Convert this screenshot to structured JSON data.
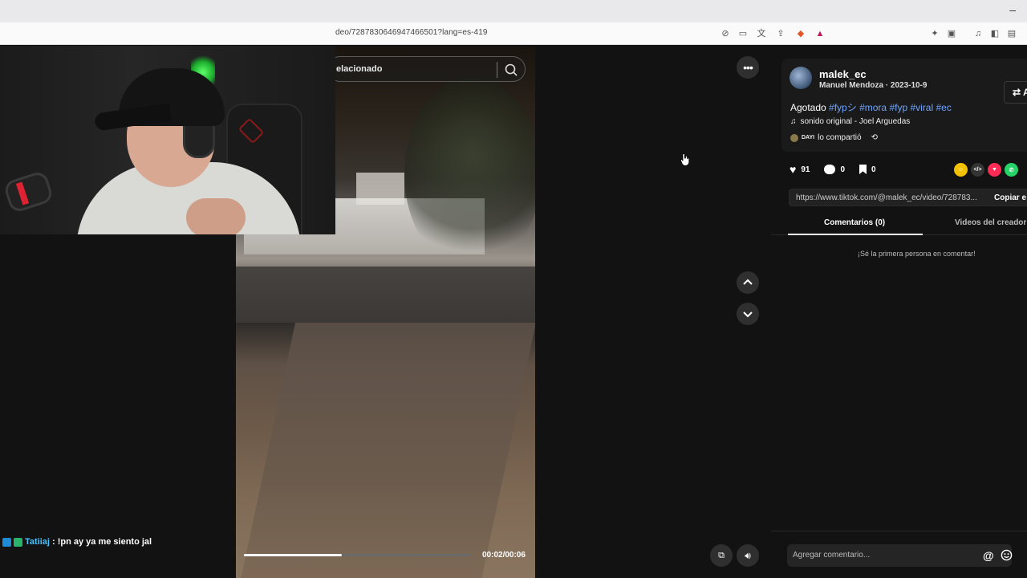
{
  "browser": {
    "url": "deo/7287830646947466501?lang=es-419",
    "window_control": "–"
  },
  "search": {
    "text": "elacionado"
  },
  "video": {
    "time": "00:02/00:06",
    "progress": 0.43
  },
  "chat": {
    "user": "Tatiiaj",
    "message": " : !pn ay ya me siento jal"
  },
  "sidebar": {
    "username": "malek_ec",
    "meta": "Manuel Mendoza · 2023-10-9",
    "follow_label": "⇄ Am",
    "desc_prefix": "Agotado ",
    "hashtags": [
      "#fypシ",
      "#mora",
      "#fyp",
      "#viral",
      "#ec"
    ],
    "sound": "sonido original - Joel Arguedas",
    "shared_by": "DAYI",
    "shared_text": "lo compartió",
    "likes": "91",
    "comments": "0",
    "saves": "0",
    "link": "https://www.tiktok.com/@malek_ec/video/728783...",
    "copy_label": "Copiar e",
    "tab_comments": "Comentarios (0)",
    "tab_videos": "Videos del creador",
    "empty_message": "¡Sé la primera persona en comentar!",
    "comment_placeholder": "Agregar comentario...",
    "comment_at": "@"
  }
}
